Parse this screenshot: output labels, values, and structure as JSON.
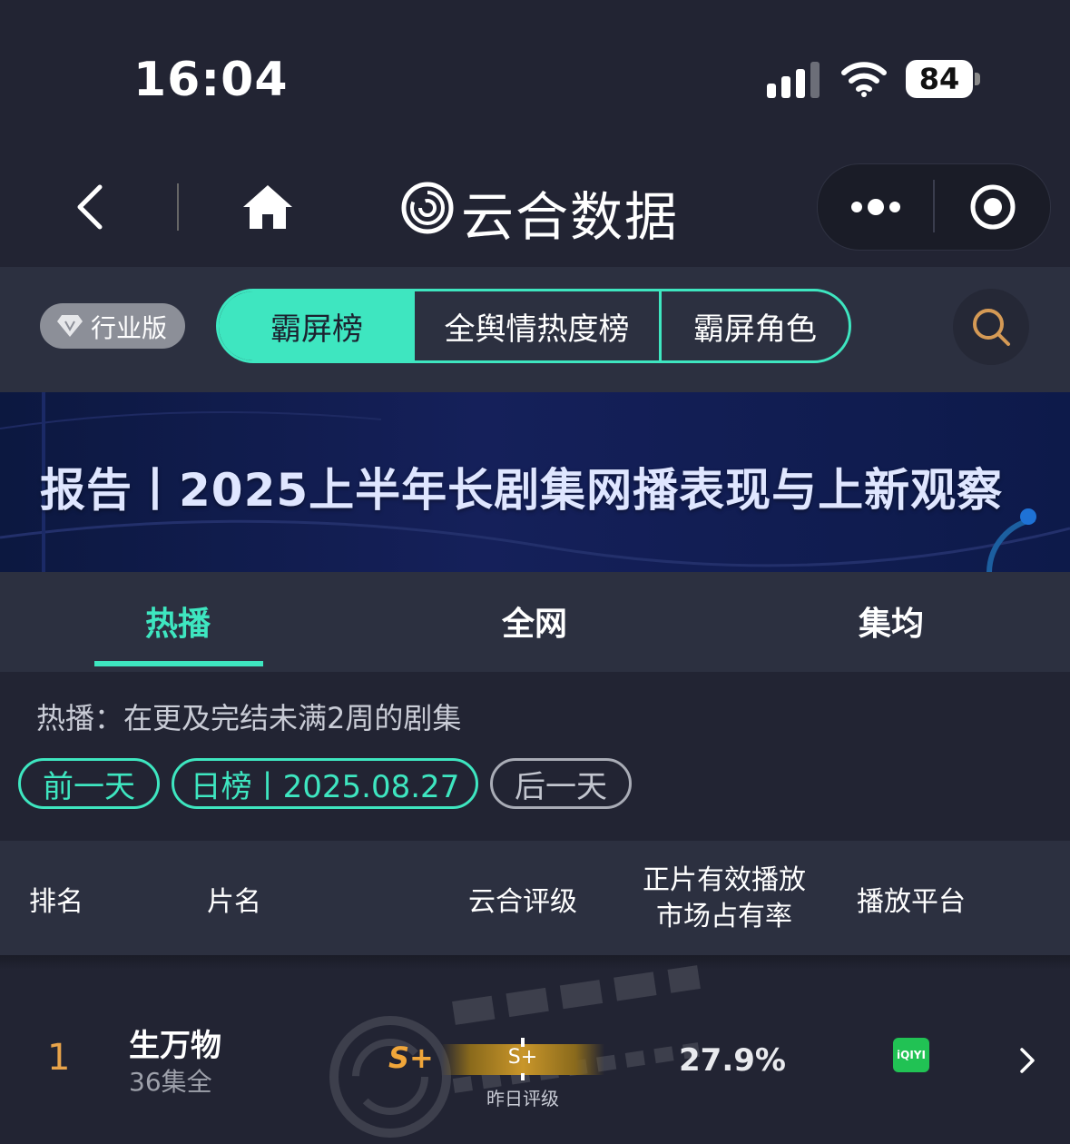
{
  "status_bar": {
    "time": "16:04",
    "battery": "84"
  },
  "nav": {
    "app_title": "云合数据"
  },
  "tabs": {
    "badge": "行业版",
    "segments": [
      "霸屏榜",
      "全舆情热度榜",
      "霸屏角色"
    ],
    "accent_color": "#3ee6c0"
  },
  "banner": {
    "text": "报告丨2025上半年长剧集网播表现与上新观察"
  },
  "subtabs": [
    "热播",
    "全网",
    "集均"
  ],
  "content": {
    "description": "热播：在更及完结未满2周的剧集",
    "prev_label": "前一天",
    "date_label": "日榜丨2025.08.27",
    "next_label": "后一天"
  },
  "table": {
    "headers": {
      "rank": "排名",
      "title": "片名",
      "grade": "云合评级",
      "share_line1": "正片有效播放",
      "share_line2": "市场占有率",
      "platform": "播放平台"
    },
    "rows": [
      {
        "rank": "1",
        "title": "生万物",
        "sub": "36集全",
        "grade": "S+",
        "bar_grade": "S+",
        "bar_caption": "昨日评级",
        "share": "27.9%",
        "platform": "iQIYI"
      }
    ]
  },
  "icons": [
    "back-icon",
    "home-icon",
    "logo-icon",
    "more-icon",
    "record-icon",
    "search-icon",
    "signal-icon",
    "wifi-icon",
    "chevron-right-icon",
    "diamond-icon"
  ]
}
